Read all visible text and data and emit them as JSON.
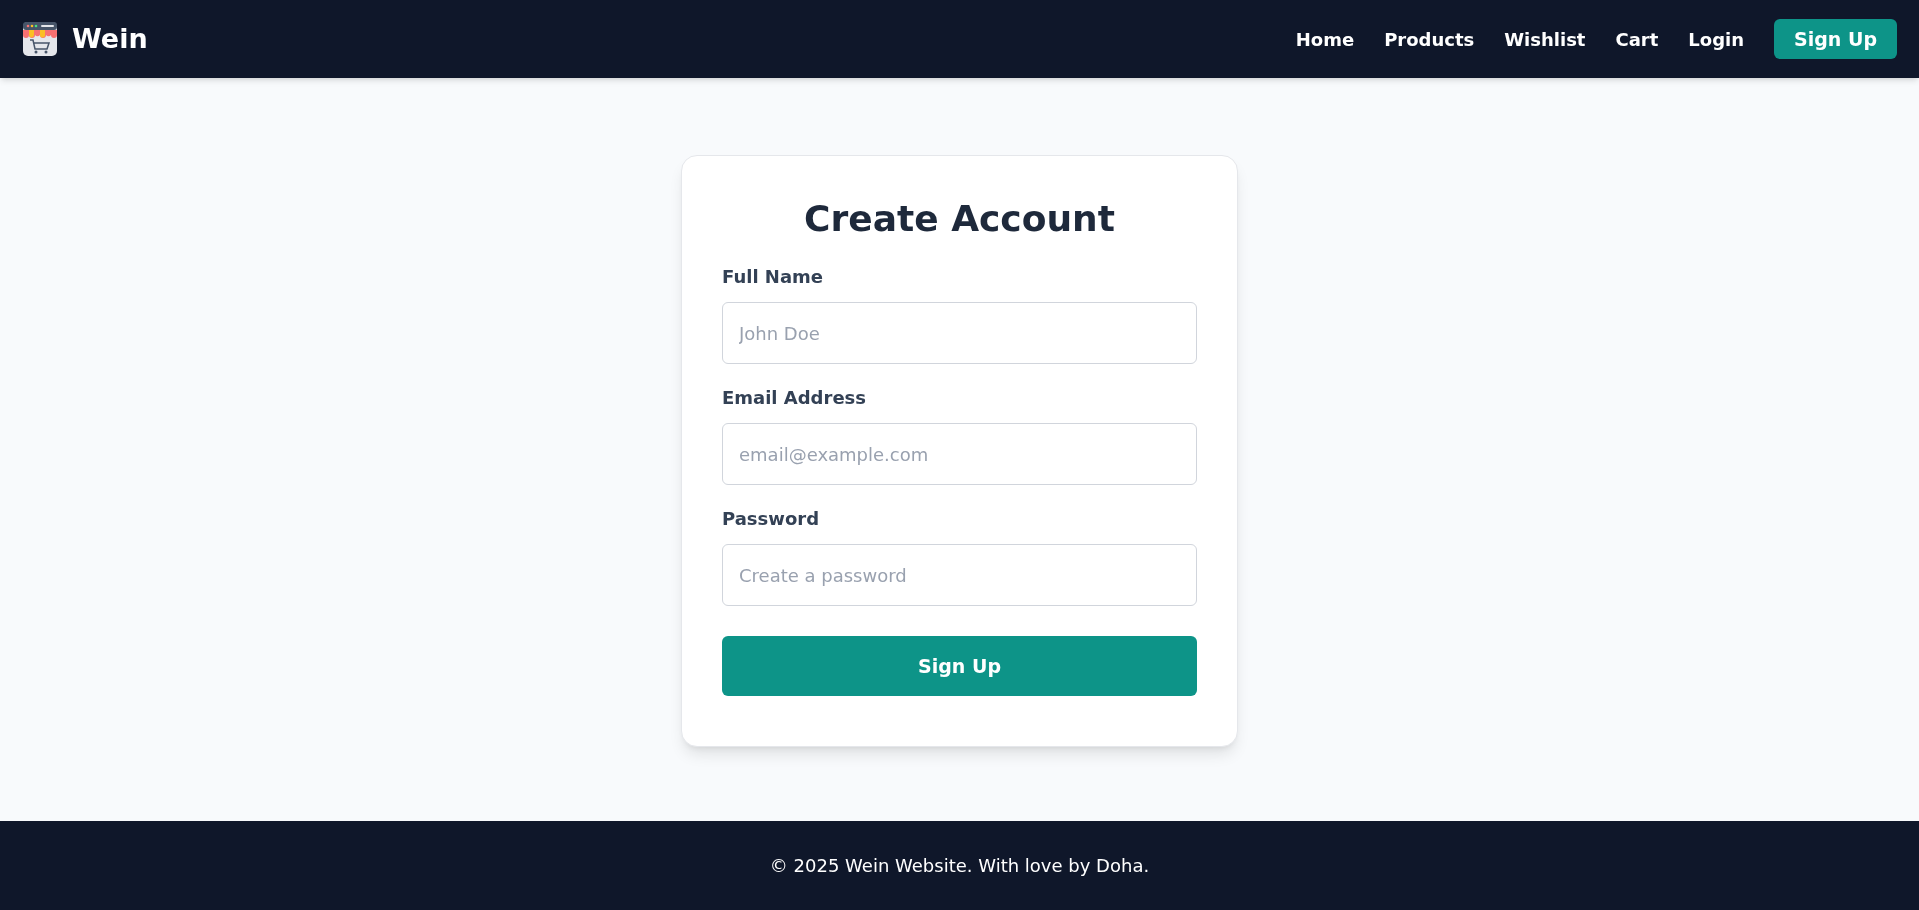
{
  "brand": {
    "name": "Wein"
  },
  "nav": [
    {
      "label": "Home",
      "kind": "link"
    },
    {
      "label": "Products",
      "kind": "link"
    },
    {
      "label": "Wishlist",
      "kind": "link"
    },
    {
      "label": "Cart",
      "kind": "link"
    },
    {
      "label": "Login",
      "kind": "link"
    },
    {
      "label": "Sign Up",
      "kind": "button"
    }
  ],
  "form": {
    "title": "Create Account",
    "fields": [
      {
        "label": "Full Name",
        "placeholder": "John Doe"
      },
      {
        "label": "Email Address",
        "placeholder": "email@example.com"
      },
      {
        "label": "Password",
        "placeholder": "Create a password"
      }
    ],
    "submit": "Sign Up"
  },
  "footer": {
    "text": "© 2025 Wein Website. With love by Doha."
  }
}
